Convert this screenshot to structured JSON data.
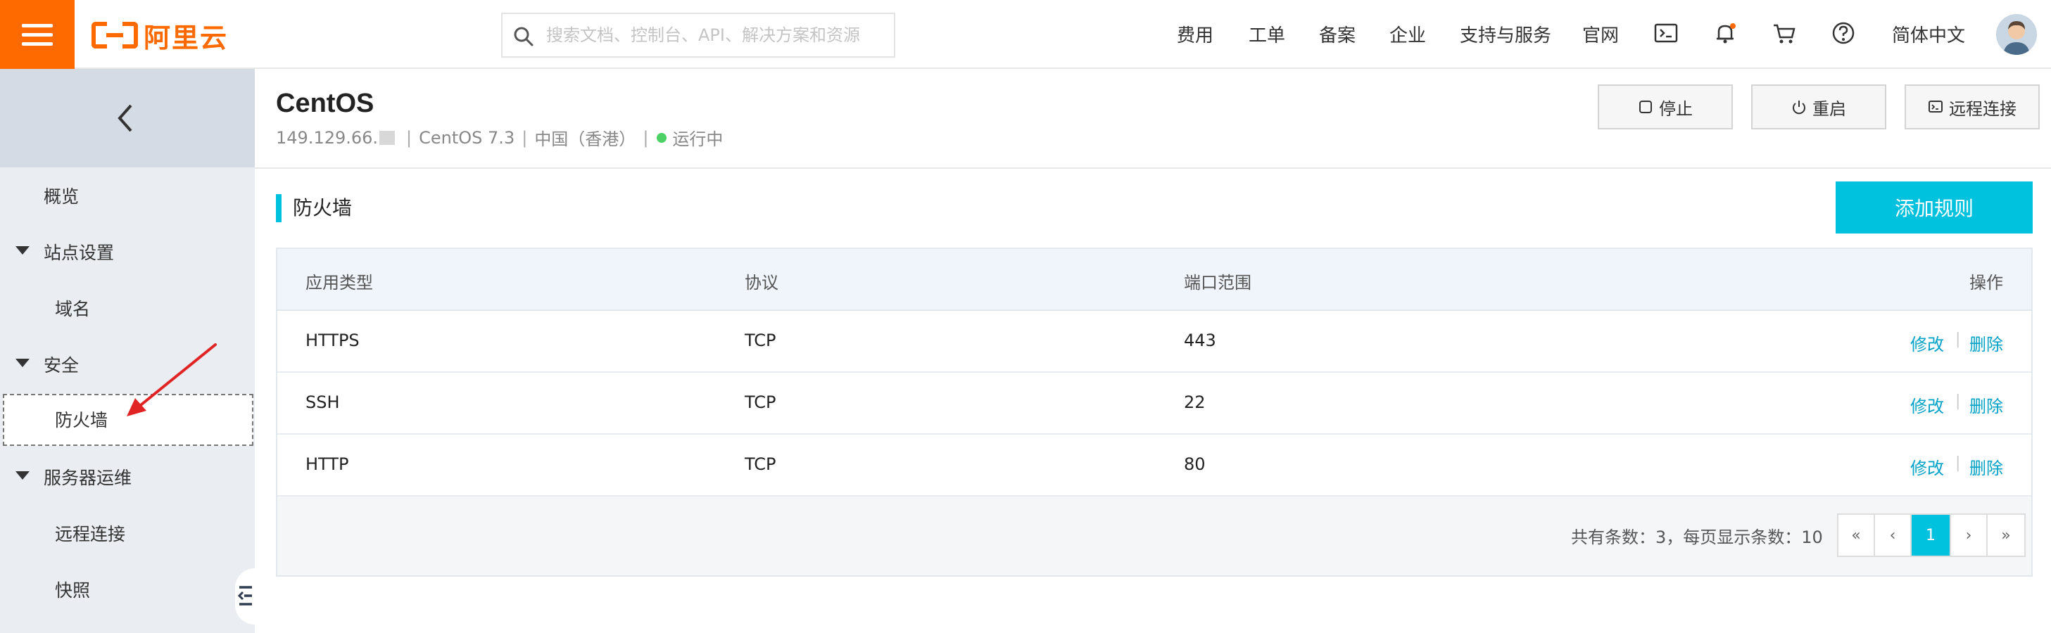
{
  "topbar": {
    "brand_text": "阿里云",
    "search_placeholder": "搜索文档、控制台、API、解决方案和资源",
    "nav": [
      "费用",
      "工单",
      "备案",
      "企业",
      "支持与服务",
      "官网"
    ],
    "language": "简体中文",
    "brand_color": "#ff6a00"
  },
  "sidebar": {
    "items": [
      {
        "label": "概览"
      },
      {
        "label": "站点设置"
      },
      {
        "label": "域名"
      },
      {
        "label": "安全"
      },
      {
        "label": "防火墙"
      },
      {
        "label": "服务器运维"
      },
      {
        "label": "远程连接"
      },
      {
        "label": "快照"
      }
    ]
  },
  "instance": {
    "name": "CentOS",
    "ip": "149.129.66.",
    "os": "CentOS 7.3",
    "region": "中国（香港）",
    "status": "运行中",
    "status_color": "#4cd264",
    "actions": {
      "stop": "停止",
      "restart": "重启",
      "remote": "远程连接"
    }
  },
  "firewall": {
    "title": "防火墙",
    "add_button": "添加规则",
    "accent": "#00c1de",
    "columns": [
      "应用类型",
      "协议",
      "端口范围",
      "操作"
    ],
    "rows": [
      {
        "app": "HTTPS",
        "protocol": "TCP",
        "port": "443"
      },
      {
        "app": "SSH",
        "protocol": "TCP",
        "port": "22"
      },
      {
        "app": "HTTP",
        "protocol": "TCP",
        "port": "80"
      }
    ],
    "edit_label": "修改",
    "delete_label": "删除",
    "separator": "|",
    "pager_info": "共有条数：3，每页显示条数：10",
    "pager": {
      "first": "«",
      "prev": "‹",
      "current": "1",
      "next": "›",
      "last": "»"
    }
  }
}
